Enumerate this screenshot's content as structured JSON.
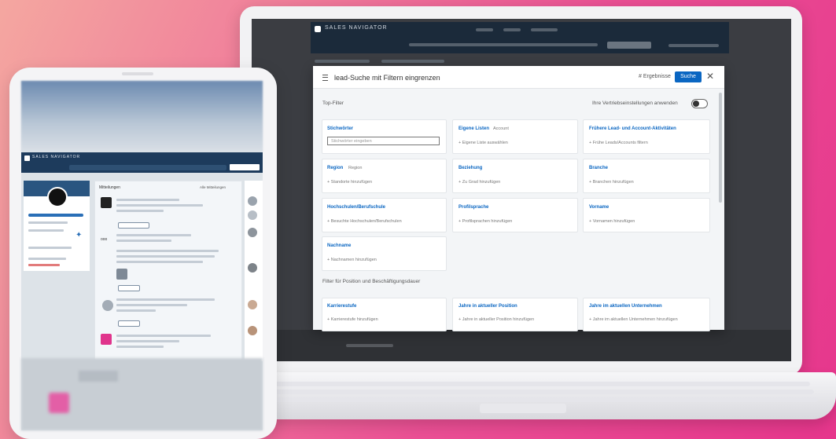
{
  "laptop": {
    "app_brand": "SALES NAVIGATOR",
    "modal": {
      "title": "lead-Suche mit Filtern eingrenzen",
      "results_label": "# Ergebnisse",
      "search_button": "Suche",
      "close_icon": "close-icon",
      "top_filter_label": "Top-Filter",
      "toggle_label": "Ihre Vertriebseinstellungen anwenden",
      "position_section_label": "Filter für Position und Beschäftigungsdauer",
      "cards": [
        {
          "title": "Stichwörter",
          "input_placeholder": "Stichwörter eingeben"
        },
        {
          "title": "Eigene Listen",
          "badge": "Account",
          "sub": "Eigene Liste auswählen"
        },
        {
          "title": "Frühere Lead- und Account-Aktivitäten",
          "sub": "Frühe Leads/Accounts filtern"
        },
        {
          "title": "Region",
          "badge": "Region",
          "sub": "Standorte hinzufügen"
        },
        {
          "title": "Beziehung",
          "sub": "Zu Grad hinzufügen"
        },
        {
          "title": "Branche",
          "sub": "Branchen hinzufügen"
        },
        {
          "title": "Hochschulen/Berufschule",
          "sub": "Besuchte Hochschulen/Berufschulen"
        },
        {
          "title": "Profilsprache",
          "sub": "Profilsprachen hinzufügen"
        },
        {
          "title": "Vorname",
          "sub": "Vornamen hinzufügen"
        },
        {
          "title": "Nachname",
          "sub": "Nachnamen hinzufügen"
        }
      ],
      "position_cards": [
        {
          "title": "Karrierestufe",
          "sub": "Karrierestufe hinzufügen"
        },
        {
          "title": "Jahre in aktueller Position",
          "sub": "Jahre in aktueller Position hinzufügen"
        },
        {
          "title": "Jahre im aktuellen Unternehmen",
          "sub": "Jahre im aktuellen Unternehmen hinzufügen"
        }
      ]
    }
  },
  "tablet": {
    "app_brand": "SALES NAVIGATOR",
    "feed_title": "Mitteilungen",
    "feed_all": "Alle Mitteilungen"
  },
  "colors": {
    "accent": "#0a66c2",
    "header": "#1b2a3a",
    "background_pink": "#e6368c"
  }
}
